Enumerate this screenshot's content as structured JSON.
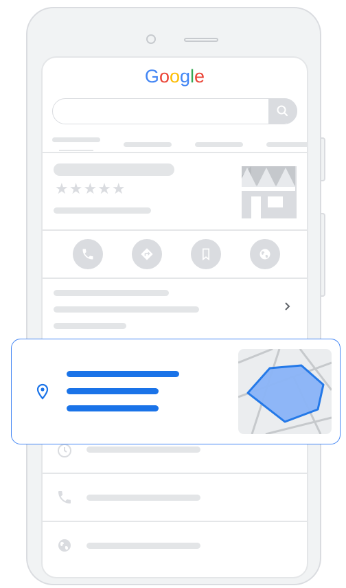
{
  "logo": {
    "letters": [
      "G",
      "o",
      "o",
      "g",
      "l",
      "e"
    ],
    "colors": [
      "#4285F4",
      "#EA4335",
      "#FBBC05",
      "#4285F4",
      "#34A853",
      "#EA4335"
    ]
  },
  "icons": {
    "search": "search-icon",
    "store": "storefront-icon",
    "call": "phone-icon",
    "directions": "directions-icon",
    "save": "bookmark-icon",
    "website": "globe-icon",
    "chevron": "chevron-right-icon",
    "location": "location-pin-icon",
    "hours": "clock-icon",
    "phone_row": "phone-icon",
    "web_row": "globe-icon"
  },
  "listing": {
    "rating_stars": 5
  },
  "colors": {
    "accent": "#1A73E8",
    "card_border": "#4285F4",
    "map_area": "#8AB4F8",
    "placeholder": "#E3E5E7",
    "icon_gray": "#DADCE0"
  }
}
